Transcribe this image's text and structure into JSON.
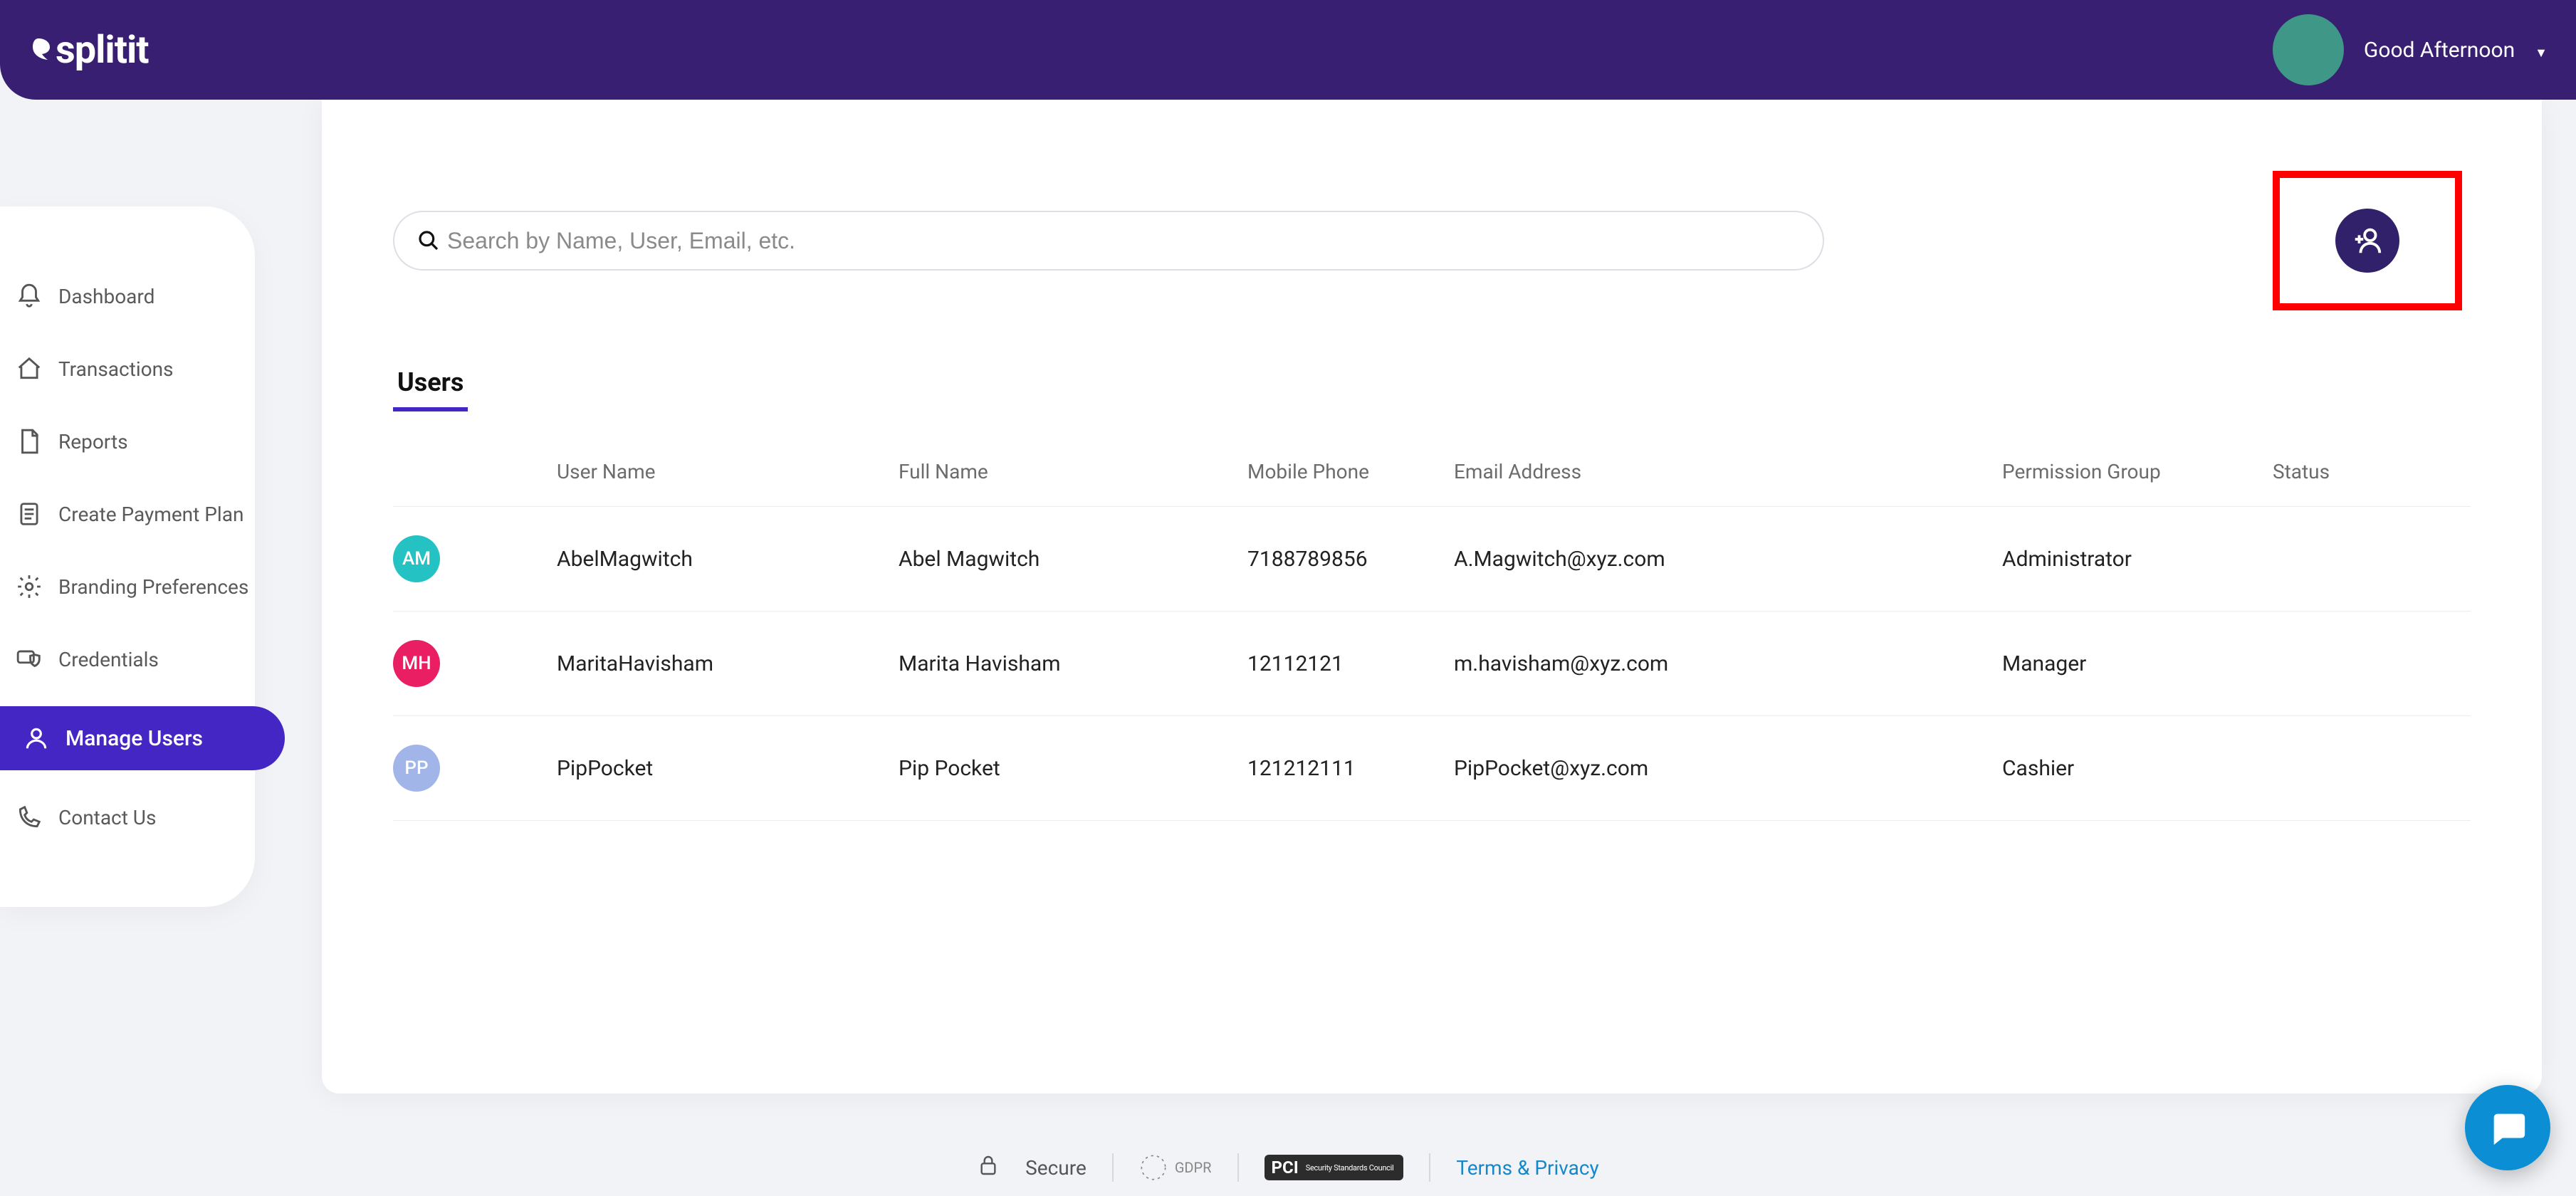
{
  "brand": {
    "name": "splitit"
  },
  "header": {
    "greeting": "Good Afternoon",
    "avatarColor": "#3f9788"
  },
  "sidebar": {
    "items": [
      {
        "label": "Dashboard",
        "icon": "bell"
      },
      {
        "label": "Transactions",
        "icon": "home"
      },
      {
        "label": "Reports",
        "icon": "document"
      },
      {
        "label": "Create Payment Plan",
        "icon": "clipboard"
      },
      {
        "label": "Branding Preferences",
        "icon": "gear"
      },
      {
        "label": "Credentials",
        "icon": "card-shield"
      },
      {
        "label": "Manage Users",
        "icon": "user",
        "active": true
      },
      {
        "label": "Contact Us",
        "icon": "phone"
      }
    ]
  },
  "search": {
    "placeholder": "Search by Name, User, Email, etc."
  },
  "tabs": [
    {
      "label": "Users"
    }
  ],
  "table": {
    "columns": [
      "User Name",
      "Full Name",
      "Mobile Phone",
      "Email Address",
      "Permission Group",
      "Status"
    ],
    "rows": [
      {
        "initials": "AM",
        "avatarColor": "#24c2c2",
        "userName": "AbelMagwitch",
        "fullName": "Abel Magwitch",
        "phone": "7188789856",
        "email": "A.Magwitch@xyz.com",
        "group": "Administrator",
        "status": ""
      },
      {
        "initials": "MH",
        "avatarColor": "#e91e63",
        "userName": "MaritaHavisham",
        "fullName": "Marita Havisham",
        "phone": "12112121",
        "email": "m.havisham@xyz.com",
        "group": "Manager",
        "status": ""
      },
      {
        "initials": "PP",
        "avatarColor": "#a1b5e8",
        "userName": "PipPocket",
        "fullName": "Pip Pocket",
        "phone": "121212111",
        "email": "PipPocket@xyz.com",
        "group": "Cashier",
        "status": ""
      }
    ]
  },
  "footer": {
    "secure": "Secure",
    "gdpr": "GDPR",
    "pciTitle": "PCI",
    "pciSub": "Security Standards Council",
    "privacy": "Terms & Privacy"
  }
}
